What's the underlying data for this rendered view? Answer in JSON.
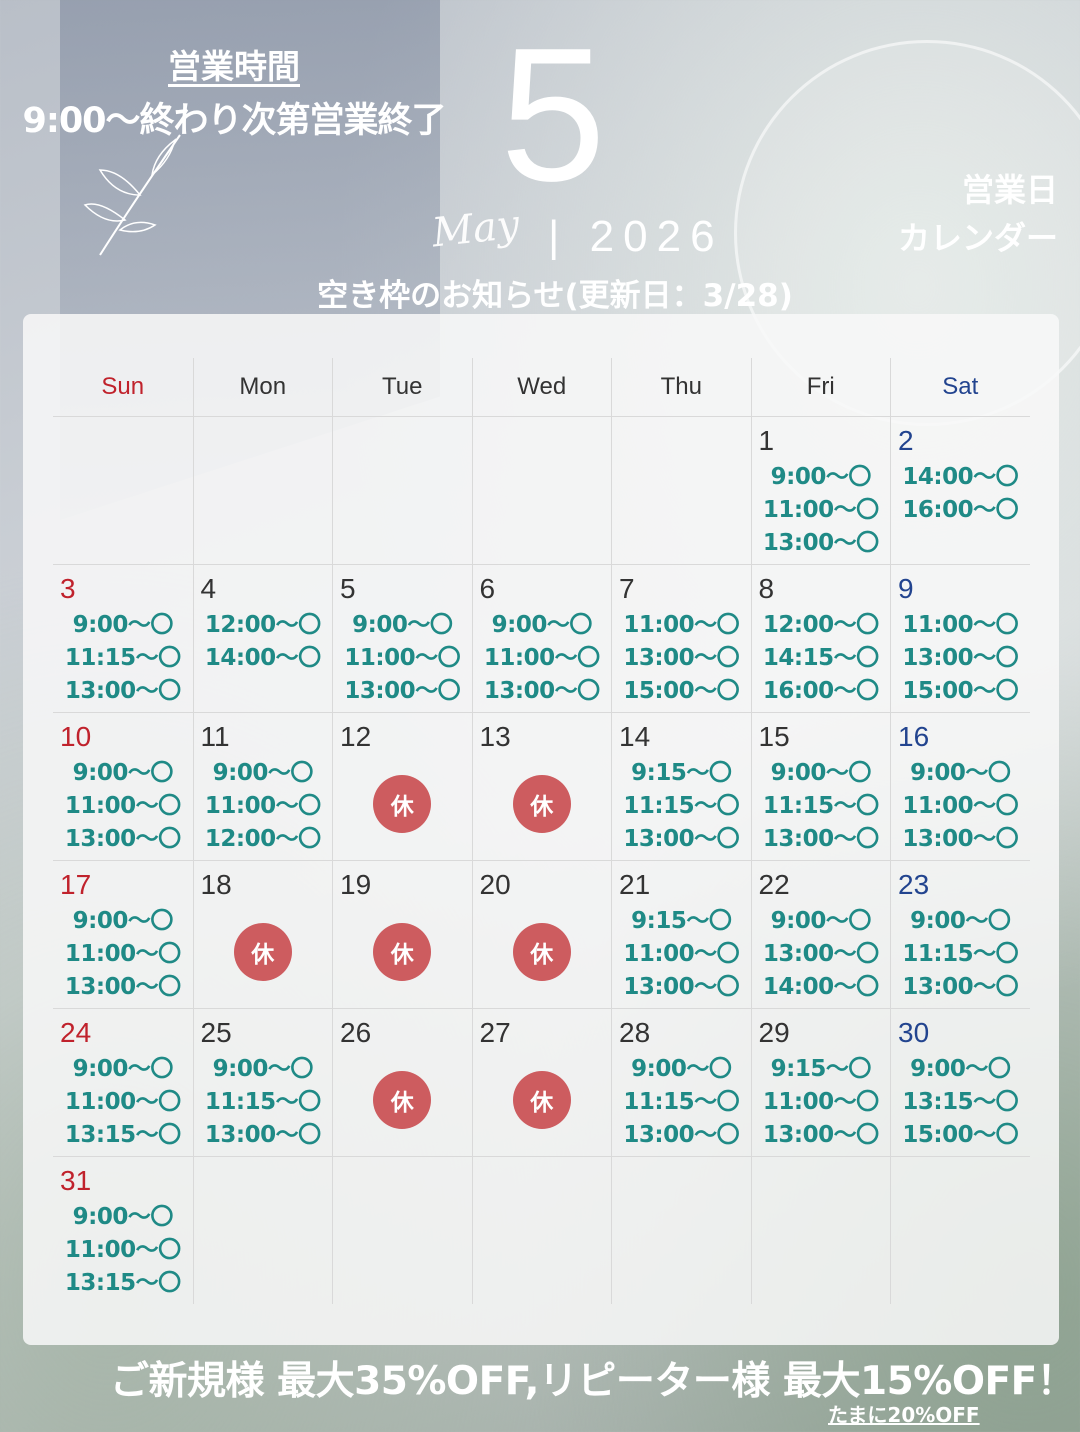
{
  "header": {
    "hours_title": "営業時間",
    "hours": "9:00〜終わり次第営業終了",
    "month_number": "5",
    "month_script": "May",
    "year": "| 2026",
    "calendar_label_line1": "営業日",
    "calendar_label_line2": "カレンダー",
    "notice": "空き枠のお知らせ(更新日：3/28)"
  },
  "calendar": {
    "weekdays": [
      "Sun",
      "Mon",
      "Tue",
      "Wed",
      "Thu",
      "Fri",
      "Sat"
    ],
    "closed_label": "休",
    "weeks": [
      [
        null,
        null,
        null,
        null,
        null,
        {
          "day": "1",
          "slots": [
            "9:00〜〇",
            "11:00〜〇",
            "13:00〜〇"
          ]
        },
        {
          "day": "2",
          "slots": [
            "14:00〜〇",
            "16:00〜〇"
          ]
        }
      ],
      [
        {
          "day": "3",
          "slots": [
            "9:00〜〇",
            "11:15〜〇",
            "13:00〜〇"
          ]
        },
        {
          "day": "4",
          "slots": [
            "12:00〜〇",
            "14:00〜〇"
          ]
        },
        {
          "day": "5",
          "slots": [
            "9:00〜〇",
            "11:00〜〇",
            "13:00〜〇"
          ]
        },
        {
          "day": "6",
          "slots": [
            "9:00〜〇",
            "11:00〜〇",
            "13:00〜〇"
          ]
        },
        {
          "day": "7",
          "slots": [
            "11:00〜〇",
            "13:00〜〇",
            "15:00〜〇"
          ]
        },
        {
          "day": "8",
          "slots": [
            "12:00〜〇",
            "14:15〜〇",
            "16:00〜〇"
          ]
        },
        {
          "day": "9",
          "slots": [
            "11:00〜〇",
            "13:00〜〇",
            "15:00〜〇"
          ]
        }
      ],
      [
        {
          "day": "10",
          "slots": [
            "9:00〜〇",
            "11:00〜〇",
            "13:00〜〇"
          ]
        },
        {
          "day": "11",
          "slots": [
            "9:00〜〇",
            "11:00〜〇",
            "12:00〜〇"
          ]
        },
        {
          "day": "12",
          "closed": true
        },
        {
          "day": "13",
          "closed": true
        },
        {
          "day": "14",
          "slots": [
            "9:15〜〇",
            "11:15〜〇",
            "13:00〜〇"
          ]
        },
        {
          "day": "15",
          "slots": [
            "9:00〜〇",
            "11:15〜〇",
            "13:00〜〇"
          ]
        },
        {
          "day": "16",
          "slots": [
            "9:00〜〇",
            "11:00〜〇",
            "13:00〜〇"
          ]
        }
      ],
      [
        {
          "day": "17",
          "slots": [
            "9:00〜〇",
            "11:00〜〇",
            "13:00〜〇"
          ]
        },
        {
          "day": "18",
          "closed": true
        },
        {
          "day": "19",
          "closed": true
        },
        {
          "day": "20",
          "closed": true
        },
        {
          "day": "21",
          "slots": [
            "9:15〜〇",
            "11:00〜〇",
            "13:00〜〇"
          ]
        },
        {
          "day": "22",
          "slots": [
            "9:00〜〇",
            "13:00〜〇",
            "14:00〜〇"
          ]
        },
        {
          "day": "23",
          "slots": [
            "9:00〜〇",
            "11:15〜〇",
            "13:00〜〇"
          ]
        }
      ],
      [
        {
          "day": "24",
          "slots": [
            "9:00〜〇",
            "11:00〜〇",
            "13:15〜〇"
          ]
        },
        {
          "day": "25",
          "slots": [
            "9:00〜〇",
            "11:15〜〇",
            "13:00〜〇"
          ]
        },
        {
          "day": "26",
          "closed": true
        },
        {
          "day": "27",
          "closed": true
        },
        {
          "day": "28",
          "slots": [
            "9:00〜〇",
            "11:15〜〇",
            "13:00〜〇"
          ]
        },
        {
          "day": "29",
          "slots": [
            "9:15〜〇",
            "11:00〜〇",
            "13:00〜〇"
          ]
        },
        {
          "day": "30",
          "slots": [
            "9:00〜〇",
            "13:15〜〇",
            "15:00〜〇"
          ]
        }
      ],
      [
        {
          "day": "31",
          "slots": [
            "9:00〜〇",
            "11:00〜〇",
            "13:15〜〇"
          ]
        },
        null,
        null,
        null,
        null,
        null,
        null
      ]
    ]
  },
  "footer": {
    "promo": "ご新規様 最大35%OFF,リピーター様 最大15%OFF！",
    "promo_sub": "たまに20%OFF"
  },
  "colors": {
    "sunday": "#c0222c",
    "saturday": "#22448f",
    "slot_text": "#1f8a86",
    "closed_badge": "#cd5c5f"
  }
}
